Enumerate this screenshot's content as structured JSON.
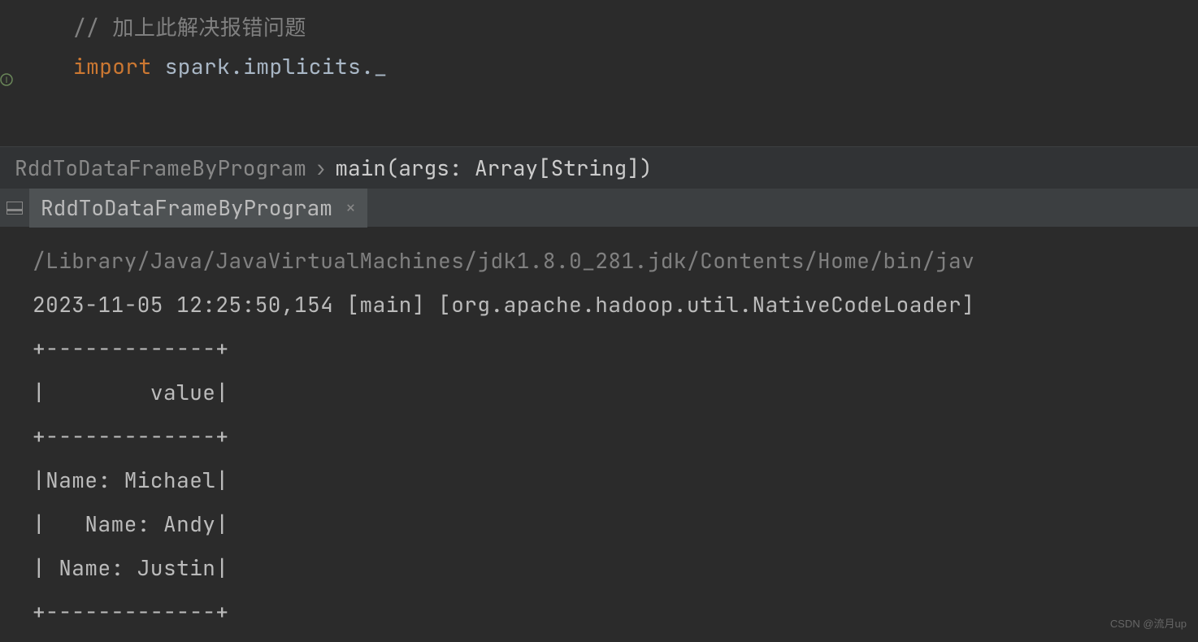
{
  "editor": {
    "comment_prefix": "//  ",
    "comment_text": "加上此解决报错问题",
    "import_keyword": "import",
    "import_path": " spark.implicits._"
  },
  "breadcrumb": {
    "class": "RddToDataFrameByProgram",
    "separator": "›",
    "method": "main(args: Array[String])"
  },
  "tab": {
    "title": "RddToDataFrameByProgram",
    "close": "×"
  },
  "console": {
    "path": "/Library/Java/JavaVirtualMachines/jdk1.8.0_281.jdk/Contents/Home/bin/jav",
    "log": "2023-11-05 12:25:50,154 [main] [org.apache.hadoop.util.NativeCodeLoader]",
    "output": [
      "+-------------+",
      "|        value|",
      "+-------------+",
      "|Name: Michael|",
      "|   Name: Andy|",
      "| Name: Justin|",
      "+-------------+"
    ]
  },
  "watermark": "CSDN @流月up"
}
